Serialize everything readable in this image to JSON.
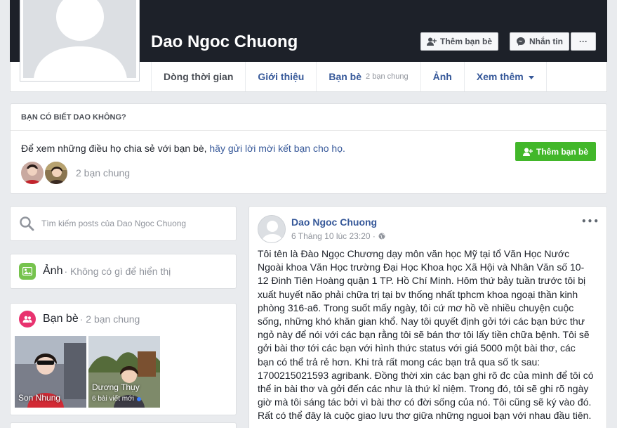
{
  "profile": {
    "name": "Dao Ngoc Chuong",
    "add_friend_label": "Thêm bạn bè",
    "message_label": "Nhắn tin",
    "more_label": "···"
  },
  "tabs": [
    {
      "label": "Dòng thời gian"
    },
    {
      "label": "Giới thiệu"
    },
    {
      "label": "Bạn bè",
      "sub": "2 bạn chung"
    },
    {
      "label": "Ảnh"
    },
    {
      "label": "Xem thêm"
    }
  ],
  "know": {
    "header": "BẠN CÓ BIẾT DAO KHÔNG?",
    "text": "Để xem những điều họ chia sẻ với bạn bè, ",
    "link": "hãy gửi lời mời kết bạn cho họ.",
    "button": "Thêm bạn bè",
    "mutual": "2 bạn chung"
  },
  "search": {
    "placeholder": "Tìm kiếm posts của Dao Ngoc Chuong"
  },
  "photos": {
    "title": "Ảnh",
    "sub": "· Không có gì để hiển thị"
  },
  "friends": {
    "title": "Bạn bè",
    "sub": "· 2 bạn chung",
    "items": [
      {
        "name": "Son Nhung",
        "meta": ""
      },
      {
        "name": "Dương Thụy",
        "meta": "6 bài viết mới"
      }
    ]
  },
  "post": {
    "author": "Dao Ngoc Chuong",
    "time": "6 Tháng 10 lúc 23:20 ·",
    "more": "•••",
    "paragraphs": [
      "Tôi tên là Đào Ngọc Chương dạy môn văn học Mỹ tại tổ Văn Học Nước Ngoài khoa Văn Học trường Đại Học Khoa học Xã Hội và Nhân Văn số 10-12 Đinh Tiên Hoàng quận 1 TP. Hồ Chí Minh. Hôm thứ bảy tuần trước tôi bị xuất huyết não phải chữa trị tại bv thống nhất tphcm khoa ngoại thần kinh phòng 316-a6. Trong suốt mấy ngày, tôi cứ mơ hồ về nhiều chuyện cuộc sống, những khó khăn gian khổ. Nay tôi quyết định gởi tới các bạn bức thư ngỏ này để nói với các bạn rằng tôi sẽ bán thơ tôi lấy tiền chữa bệnh. Tôi sẽ gởi bài thơ tới các bạn với hình thức status với giá 5000 một bài thơ, các bạn có thể trả rẻ hơn. Khi trả rất mong các bạn trả qua số tk sau: 1700215021593 agribank. Đồng thời xin các bạn ghi rõ đc của mình để tôi có thể in bài thơ và gởi đến các như là thứ kỉ niệm. Trong đó, tôi sẽ ghi rõ ngày giờ mà tôi sáng tác bởi vì bài thơ có đời sống của nó. Tôi cũng sẽ ký vào đó.",
      "Rất có thể đây là cuộc giao lưu thơ giữa những nguoi bạn với nhau đầu tiên."
    ]
  },
  "colors": {
    "link": "#365899",
    "green": "#42b72a",
    "cover": "#1d2129"
  }
}
